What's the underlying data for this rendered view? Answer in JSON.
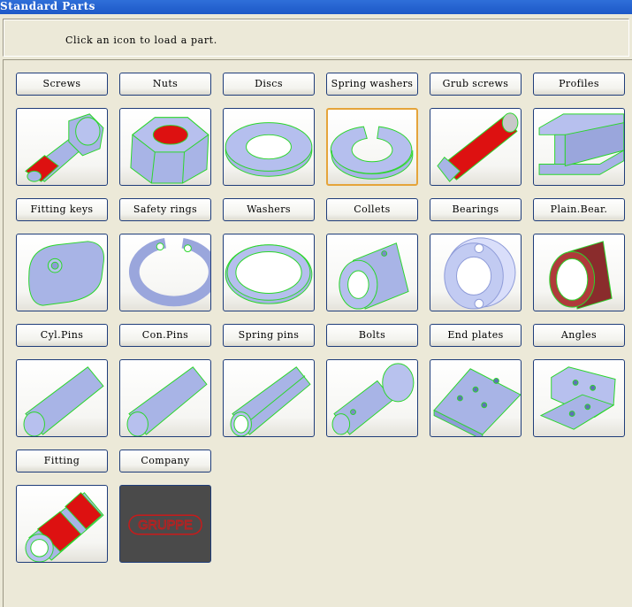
{
  "window": {
    "title": "Standard Parts"
  },
  "instruction": "Click an icon to load a part.",
  "company_logo_text": "GRUPPE",
  "colors": {
    "part_blue": "#a8b4e6",
    "part_edge": "#2bd62b",
    "part_red": "#dd1111",
    "selected_border": "#e5a43a"
  },
  "parts": [
    {
      "label": "Screws",
      "icon": "screw-icon",
      "selected": false
    },
    {
      "label": "Nuts",
      "icon": "nut-icon",
      "selected": false
    },
    {
      "label": "Discs",
      "icon": "disc-icon",
      "selected": false
    },
    {
      "label": "Spring washers",
      "icon": "spring-washer-icon",
      "selected": true
    },
    {
      "label": "Grub screws",
      "icon": "grub-screw-icon",
      "selected": false
    },
    {
      "label": "Profiles",
      "icon": "profile-icon",
      "selected": false
    },
    {
      "label": "Fitting keys",
      "icon": "fitting-key-icon",
      "selected": false
    },
    {
      "label": "Safety rings",
      "icon": "safety-ring-icon",
      "selected": false
    },
    {
      "label": "Washers",
      "icon": "washer-icon",
      "selected": false
    },
    {
      "label": "Collets",
      "icon": "collet-icon",
      "selected": false
    },
    {
      "label": "Bearings",
      "icon": "bearing-icon",
      "selected": false
    },
    {
      "label": "Plain.Bear.",
      "icon": "plain-bearing-icon",
      "selected": false
    },
    {
      "label": "Cyl.Pins",
      "icon": "cylindrical-pin-icon",
      "selected": false
    },
    {
      "label": "Con.Pins",
      "icon": "conical-pin-icon",
      "selected": false
    },
    {
      "label": "Spring pins",
      "icon": "spring-pin-icon",
      "selected": false
    },
    {
      "label": "Bolts",
      "icon": "bolt-icon",
      "selected": false
    },
    {
      "label": "End plates",
      "icon": "end-plate-icon",
      "selected": false
    },
    {
      "label": "Angles",
      "icon": "angle-icon",
      "selected": false
    },
    {
      "label": "Fitting",
      "icon": "fitting-icon",
      "selected": false
    },
    {
      "label": "Company",
      "icon": "company-logo-icon",
      "selected": false
    }
  ]
}
